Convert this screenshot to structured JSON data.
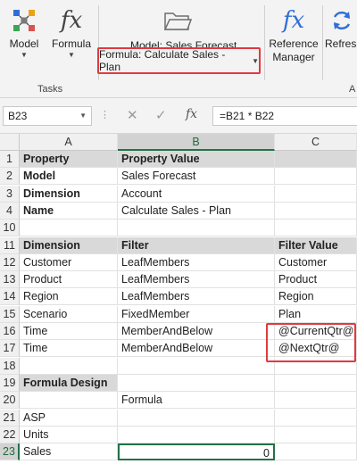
{
  "ribbon": {
    "model_btn": "Model",
    "formula_btn": "Formula",
    "model_label": "Model: Sales Forecast",
    "formula_dropdown": "Formula: Calculate Sales - Plan",
    "reference_manager_line1": "Reference",
    "reference_manager_line2": "Manager",
    "refresh_label": "Refres",
    "group_tasks": "Tasks",
    "group_a": "A",
    "fx_glyph": "fx"
  },
  "formula_bar": {
    "name_box": "B23",
    "formula": "=B21 * B22",
    "fx_glyph": "fx",
    "dots": "⋮",
    "cancel_glyph": "✕",
    "enter_glyph": "✓"
  },
  "columns": [
    "A",
    "B",
    "C"
  ],
  "rows": [
    {
      "num": "1",
      "a": "Property",
      "b": "Property Value",
      "c": ""
    },
    {
      "num": "2",
      "a": "Model",
      "b": "Sales Forecast",
      "c": ""
    },
    {
      "num": "3",
      "a": "Dimension",
      "b": "Account",
      "c": ""
    },
    {
      "num": "4",
      "a": "Name",
      "b": "Calculate Sales - Plan",
      "c": ""
    },
    {
      "num": "10",
      "a": "",
      "b": "",
      "c": ""
    },
    {
      "num": "11",
      "a": "Dimension",
      "b": "Filter",
      "c": "Filter Value"
    },
    {
      "num": "12",
      "a": "Customer",
      "b": "LeafMembers",
      "c": "Customer"
    },
    {
      "num": "13",
      "a": "Product",
      "b": "LeafMembers",
      "c": "Product"
    },
    {
      "num": "14",
      "a": "Region",
      "b": "LeafMembers",
      "c": "Region"
    },
    {
      "num": "15",
      "a": "Scenario",
      "b": "FixedMember",
      "c": "Plan"
    },
    {
      "num": "16",
      "a": "Time",
      "b": "MemberAndBelow",
      "c": "@CurrentQtr@"
    },
    {
      "num": "17",
      "a": "Time",
      "b": "MemberAndBelow",
      "c": "@NextQtr@"
    },
    {
      "num": "18",
      "a": "",
      "b": "",
      "c": ""
    },
    {
      "num": "19",
      "a": "Formula Design",
      "b": "",
      "c": ""
    },
    {
      "num": "20",
      "a": "",
      "b": "Formula",
      "c": ""
    },
    {
      "num": "21",
      "a": "ASP",
      "b": "",
      "c": ""
    },
    {
      "num": "22",
      "a": "Units",
      "b": "",
      "c": ""
    },
    {
      "num": "23",
      "a": "Sales",
      "b": "0",
      "c": ""
    }
  ],
  "selected_cell": "B23",
  "colors": {
    "highlight_red": "#e03a3e",
    "excel_green": "#217346",
    "icon_blue": "#2e6fd8"
  }
}
